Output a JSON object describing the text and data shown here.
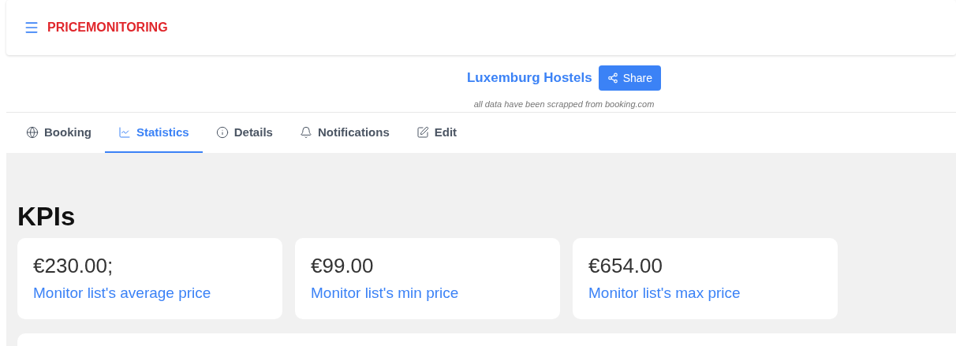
{
  "app": {
    "brand": "PRICEMONITORING"
  },
  "header": {
    "title": "Luxemburg Hostels",
    "share_button": "Share",
    "subtitle": "all data have been scrapped from booking.com"
  },
  "tabs": [
    {
      "label": "Booking",
      "selected": false
    },
    {
      "label": "Statistics",
      "selected": true
    },
    {
      "label": "Details",
      "selected": false
    },
    {
      "label": "Notifications",
      "selected": false
    },
    {
      "label": "Edit",
      "selected": false
    }
  ],
  "kpis": {
    "heading": "KPIs",
    "cards": [
      {
        "value": "€230.00;",
        "label": "Monitor list's average price"
      },
      {
        "value": "€99.00",
        "label": "Monitor list's min price"
      },
      {
        "value": "€654.00",
        "label": "Monitor list's max price"
      }
    ]
  }
}
